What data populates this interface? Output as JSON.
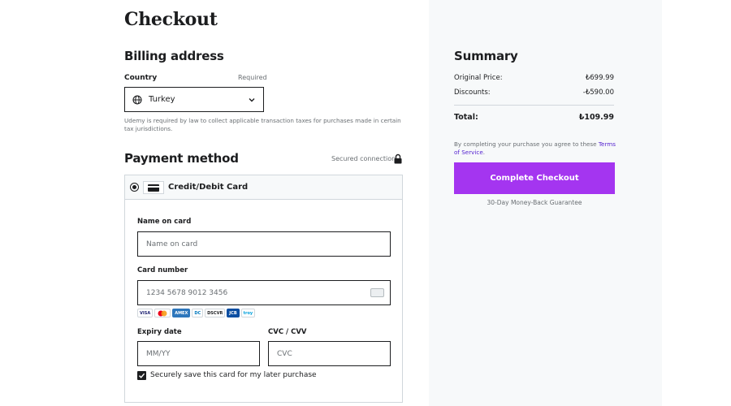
{
  "checkout": {
    "title": "Checkout",
    "billing": {
      "heading": "Billing address",
      "country_label": "Country",
      "required_label": "Required",
      "country_value": "Turkey",
      "tax_note": "Udemy is required by law to collect applicable transaction taxes for purchases made in certain tax jurisdictions."
    },
    "payment": {
      "heading": "Payment method",
      "secured_label": "Secured connection",
      "method_label": "Credit/Debit Card",
      "method_selected": true,
      "name_label": "Name on card",
      "name_placeholder": "Name on card",
      "number_label": "Card number",
      "number_placeholder": "1234 5678 9012 3456",
      "brands": [
        "VISA",
        "MC",
        "AMEX",
        "DC",
        "DSCVR",
        "JCB",
        "troy"
      ],
      "expiry_label": "Expiry date",
      "expiry_placeholder": "MM/YY",
      "cvc_label": "CVC / CVV",
      "cvc_placeholder": "CVC",
      "save_card_label": "Securely save this card for my later purchase",
      "save_card_checked": true
    }
  },
  "summary": {
    "heading": "Summary",
    "original_price_label": "Original Price:",
    "original_price_value": "₺699.99",
    "discounts_label": "Discounts:",
    "discounts_value": "-₺590.00",
    "total_label": "Total:",
    "total_value": "₺109.99",
    "terms_prefix": "By completing your purchase you agree to these ",
    "terms_link": "Terms of Service",
    "terms_suffix": ".",
    "cta_label": "Complete Checkout",
    "guarantee": "30-Day Money-Back Guarantee"
  },
  "colors": {
    "accent": "#a435f0",
    "link": "#5624d0",
    "panel_bg": "#f7f9fa",
    "text": "#1c1d1f",
    "muted": "#6a6f73"
  }
}
